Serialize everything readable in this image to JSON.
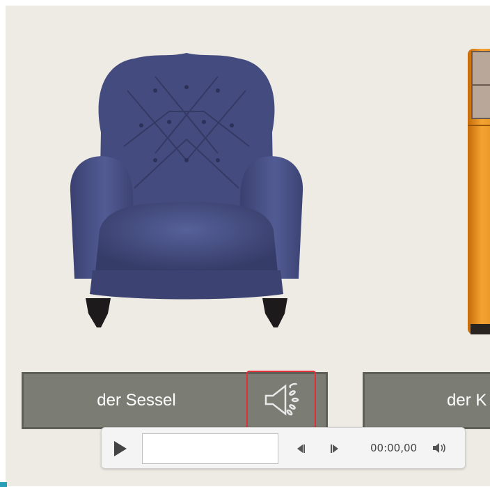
{
  "slide": {
    "items": [
      {
        "label": "der Sessel",
        "image": "armchair",
        "color": "#4a507e"
      },
      {
        "label": "der K",
        "image": "cabinet",
        "color": "#e08a1c"
      }
    ]
  },
  "media_player": {
    "time": "00:00,00",
    "icons": [
      "play-icon",
      "previous-frame-icon",
      "next-frame-icon",
      "volume-icon"
    ]
  },
  "sound_icon": "speaker-icon",
  "highlight_color": "#e0303a"
}
